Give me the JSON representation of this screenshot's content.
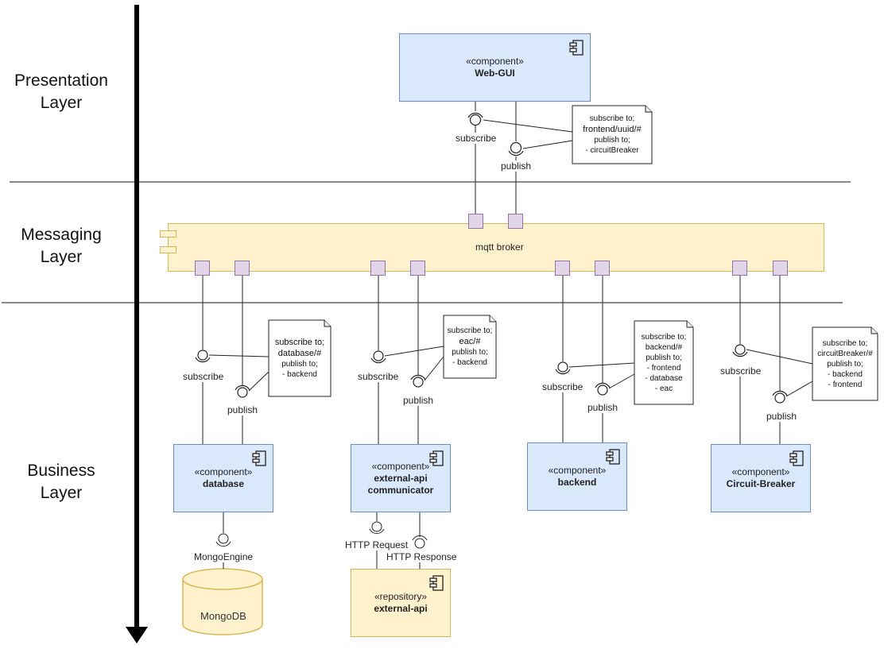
{
  "layers": [
    {
      "id": "presentation",
      "label": "Presentation\nLayer"
    },
    {
      "id": "messaging",
      "label": "Messaging\nLayer"
    },
    {
      "id": "business",
      "label": "Business\nLayer"
    }
  ],
  "components": {
    "web_gui": {
      "stereotype": "«component»",
      "name": "Web-GUI"
    },
    "database": {
      "stereotype": "«component»",
      "name": "database"
    },
    "external_api_communicator": {
      "stereotype": "«component»",
      "name": "external-api\ncommunicator"
    },
    "backend": {
      "stereotype": "«component»",
      "name": "backend"
    },
    "circuit_breaker": {
      "stereotype": "«component»",
      "name": "Circuit-Breaker"
    },
    "external_api": {
      "stereotype": "«repository»",
      "name": "external-api"
    }
  },
  "broker": {
    "label": "mqtt broker"
  },
  "database_store": {
    "label": "MongoDB"
  },
  "interfaces": {
    "subscribe": "subscribe",
    "publish": "publish",
    "mongo_engine": "MongoEngine",
    "http_request": "HTTP Request",
    "http_response": "HTTP Response"
  },
  "notes": {
    "web_gui": {
      "sub_title": "subscribe to;",
      "sub_topic": "frontend/uuid/#",
      "pub_title": "publish to;",
      "pub_targets": [
        "- circuitBreaker"
      ]
    },
    "database": {
      "sub_title": "subscribe to;",
      "sub_topic": "database/#",
      "pub_title": "publish to;",
      "pub_targets": [
        "- backend"
      ]
    },
    "external_api_communicator": {
      "sub_title": "subscribe to;",
      "sub_topic": "eac/#",
      "pub_title": "publish to;",
      "pub_targets": [
        "- backend"
      ]
    },
    "backend": {
      "sub_title": "subscribe to;",
      "sub_topic": "backend/#",
      "pub_title": "publish to;",
      "pub_targets": [
        "- frontend",
        "- database",
        "- eac"
      ]
    },
    "circuit_breaker": {
      "sub_title": "subscribe to;",
      "sub_topic": "circuitBreaker/#",
      "pub_title": "publish to;",
      "pub_targets": [
        "- backend",
        "- frontend"
      ]
    }
  }
}
